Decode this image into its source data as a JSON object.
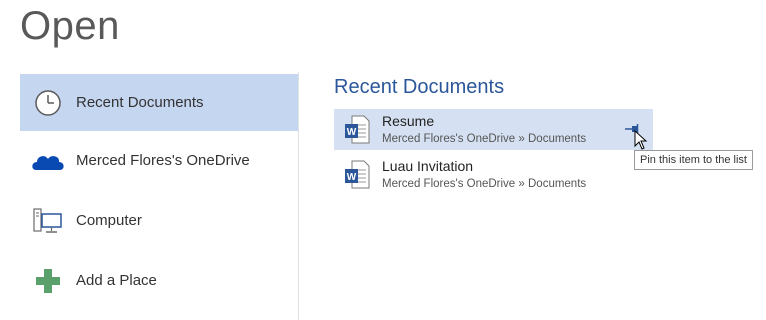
{
  "page": {
    "title": "Open"
  },
  "places": [
    {
      "label": "Recent Documents",
      "icon": "clock-icon",
      "selected": true
    },
    {
      "label": "Merced Flores's OneDrive",
      "icon": "onedrive-cloud-icon",
      "selected": false
    },
    {
      "label": "Computer",
      "icon": "computer-icon",
      "selected": false
    },
    {
      "label": "Add a Place",
      "icon": "plus-icon",
      "selected": false
    }
  ],
  "recent": {
    "title": "Recent Documents",
    "documents": [
      {
        "name": "Resume",
        "path": "Merced Flores's OneDrive » Documents",
        "icon": "word-document-icon",
        "hovered": true
      },
      {
        "name": "Luau Invitation",
        "path": "Merced Flores's OneDrive » Documents",
        "icon": "word-document-icon",
        "hovered": false
      }
    ]
  },
  "tooltip": {
    "text": "Pin this item to the list"
  },
  "colors": {
    "selected_bg": "#c5d6f0",
    "hover_bg": "#d5e1f2",
    "accent": "#2b579a",
    "add_place_green": "#5aa06b",
    "onedrive_blue": "#094ab2"
  }
}
